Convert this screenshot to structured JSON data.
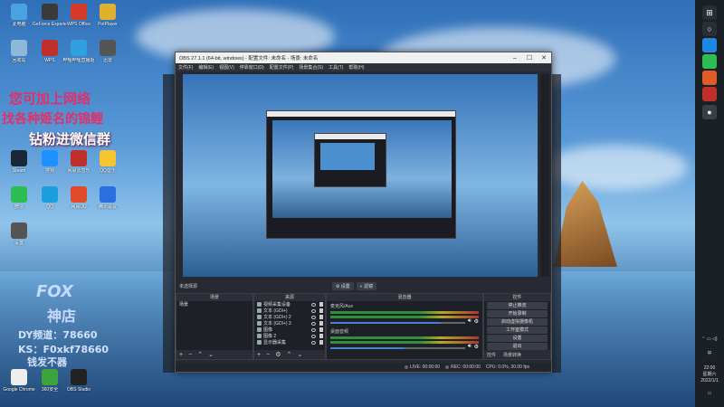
{
  "desktop_icons": [
    {
      "label": "此电脑",
      "color": "#4aa3e0"
    },
    {
      "label": "GeForce Experience",
      "color": "#3a3a3a"
    },
    {
      "label": "WPS Office",
      "color": "#d43a2a"
    },
    {
      "label": "PotPlayer",
      "color": "#e0b030"
    },
    {
      "label": "回收站",
      "color": "#8fb8d8"
    },
    {
      "label": "WPS",
      "color": "#c0302a"
    },
    {
      "label": "哔哩哔哩直播姬",
      "color": "#2fa0e0"
    },
    {
      "label": "迅雷",
      "color": "#555"
    },
    {
      "label": "Steam",
      "color": "#1b2838"
    },
    {
      "label": "搜狗",
      "color": "#1e90ff"
    },
    {
      "label": "网易云音乐",
      "color": "#c0302a"
    },
    {
      "label": "QQ音乐",
      "color": "#f5c431"
    },
    {
      "label": "微信",
      "color": "#2dbd55"
    },
    {
      "label": "QQ",
      "color": "#1a9fe0"
    },
    {
      "label": "网易UU",
      "color": "#e04a2a"
    },
    {
      "label": "腾讯会议",
      "color": "#2a6fe0"
    },
    {
      "label": "Google Chrome",
      "color": "#eee"
    },
    {
      "label": "360安全",
      "color": "#3ba53b"
    },
    {
      "label": "OBS Studio",
      "color": "#222"
    },
    {
      "label": "设置",
      "color": "#555"
    }
  ],
  "overlay": {
    "line1": "您可加上网络",
    "line2": "找各种姬名的锦鲤",
    "line3": "钻粉进微信群",
    "fox": "FOX",
    "shop": "神店",
    "dy": "DY频道：78660",
    "ks": "KS：F0xkf78660",
    "tag": "钱发不器"
  },
  "obs": {
    "title": "OBS 27.1.1 (64-bit, windows) - 配置文件: 未命名 - 场景: 未命名",
    "menu": [
      "文件(F)",
      "编辑(E)",
      "视图(V)",
      "停靠窗口(D)",
      "配置文件(P)",
      "场景集合(S)",
      "工具(T)",
      "帮助(H)"
    ],
    "preview_buttons": [
      "⚙ 设置",
      "◐ 滤镜"
    ],
    "transition_label": "未选择源",
    "docks": {
      "scenes": {
        "title": "场景",
        "items": [
          "场景"
        ]
      },
      "sources": {
        "title": "来源",
        "items": [
          "视频采集设备",
          "文本 (GDI+)",
          "文本 (GDI+) 2",
          "文本 (GDI+) 3",
          "图像",
          "图像 2",
          "显示器采集"
        ]
      },
      "mixer": {
        "title": "混音器",
        "channels": [
          {
            "name": "麦克风/Aux",
            "level": 0.82
          },
          {
            "name": "桌面音频",
            "level": 0.55
          }
        ]
      },
      "controls": {
        "title": "控件",
        "buttons": [
          "停止推流",
          "开始录制",
          "启动虚拟摄像机",
          "工作室模式",
          "设置",
          "退出"
        ],
        "tabs": [
          "控件",
          "场景转换"
        ]
      }
    },
    "status": {
      "live": "LIVE: 00:00:00",
      "rec": "REC: 00:00:00",
      "cpu": "CPU: 0.0%, 30.00 fps"
    }
  },
  "taskbar": {
    "time": "22:00",
    "day": "星期六",
    "date": "2022/1/1"
  }
}
